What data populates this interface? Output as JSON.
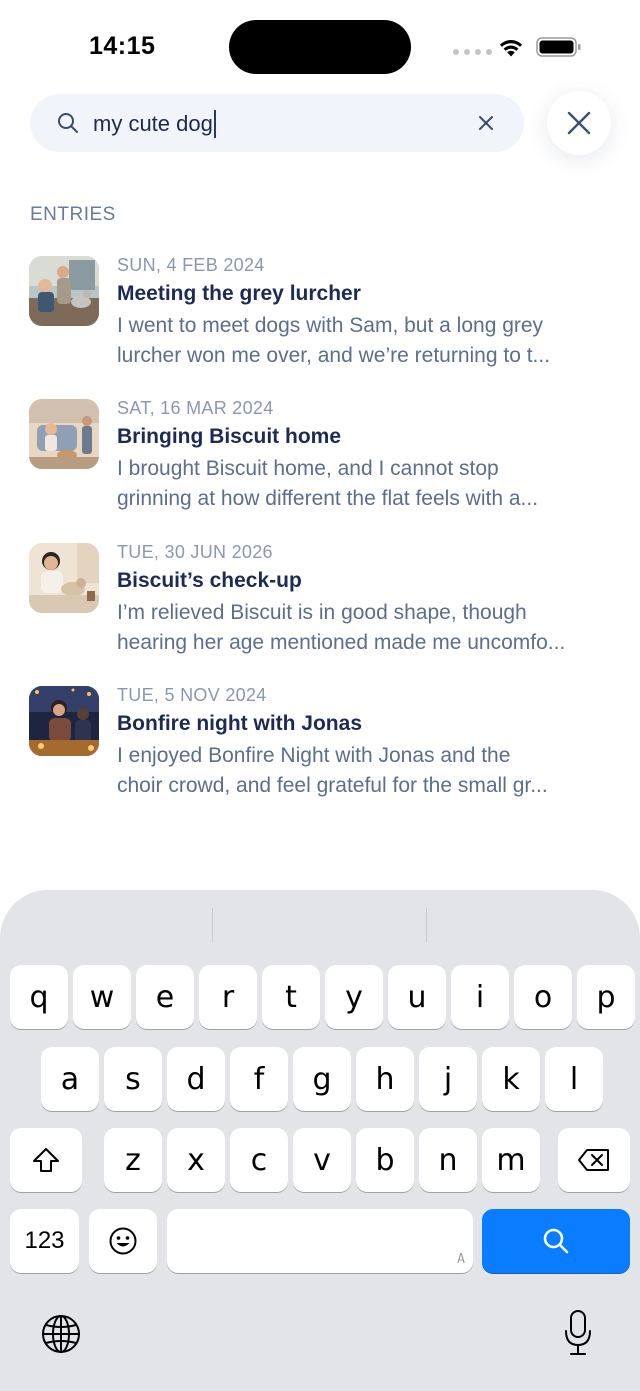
{
  "status_bar": {
    "time": "14:15"
  },
  "search": {
    "query": "my cute dog"
  },
  "section_header": "ENTRIES",
  "entries": [
    {
      "date": "SUN, 4 FEB 2024",
      "title": "Meeting the grey lurcher",
      "excerpt_line1": "I went to meet dogs with Sam, but a long grey",
      "excerpt_line2": "lurcher won me over, and we’re returning to t..."
    },
    {
      "date": "SAT, 16 MAR 2024",
      "title": "Bringing Biscuit home",
      "excerpt_line1": "I brought Biscuit home, and I cannot stop",
      "excerpt_line2": "grinning at how different the flat feels with a..."
    },
    {
      "date": "TUE, 30 JUN 2026",
      "title": "Biscuit’s check-up",
      "excerpt_line1": "I’m relieved Biscuit is in good shape, though",
      "excerpt_line2": "hearing her age mentioned made me uncomfo..."
    },
    {
      "date": "TUE, 5 NOV 2024",
      "title": "Bonfire night with Jonas",
      "excerpt_line1": "I enjoyed Bonfire Night with Jonas and the",
      "excerpt_line2": "choir crowd, and feel grateful for the small gr..."
    }
  ],
  "keyboard": {
    "row1": [
      "q",
      "w",
      "e",
      "r",
      "t",
      "y",
      "u",
      "i",
      "o",
      "p"
    ],
    "row2": [
      "a",
      "s",
      "d",
      "f",
      "g",
      "h",
      "j",
      "k",
      "l"
    ],
    "row3": [
      "z",
      "x",
      "c",
      "v",
      "b",
      "n",
      "m"
    ],
    "numbers_key": "123",
    "space_hint": "A",
    "accent_color": "#0a7cff"
  }
}
